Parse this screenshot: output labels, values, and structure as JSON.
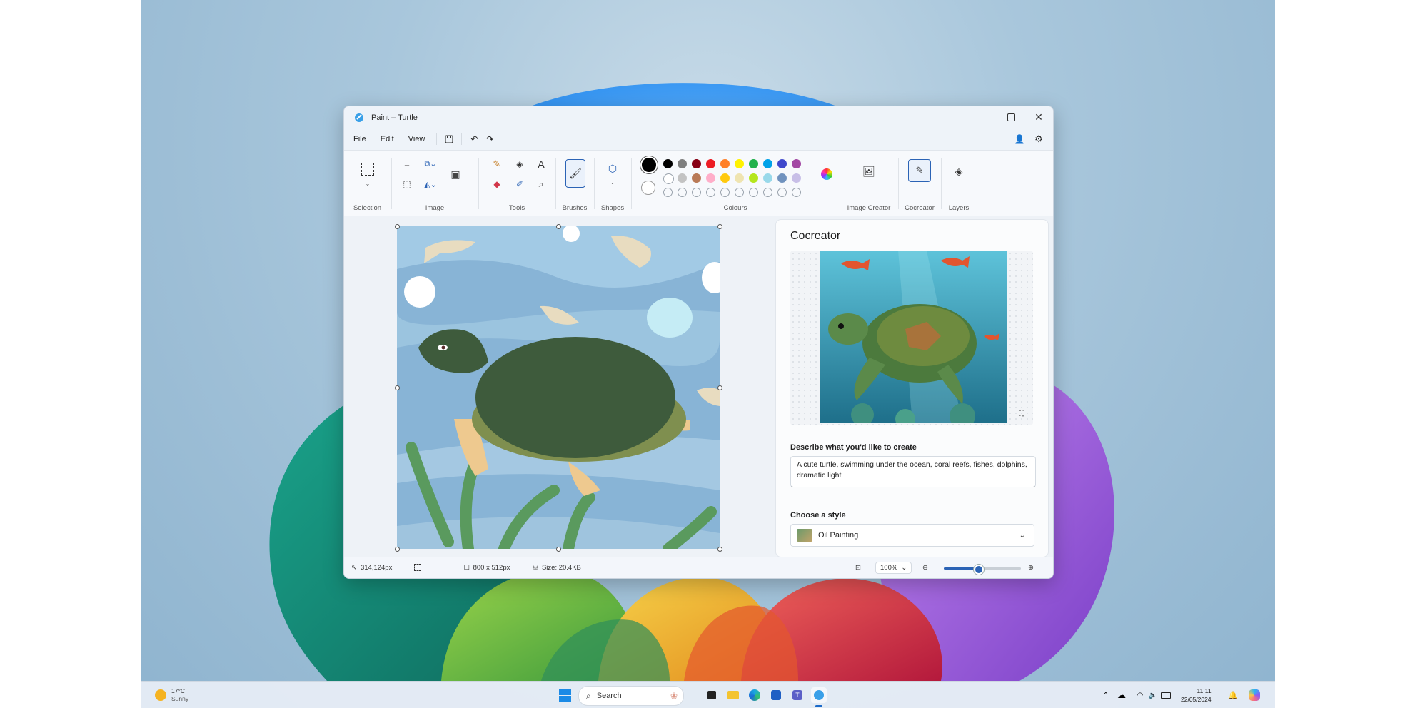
{
  "window": {
    "title": "Paint – Turtle",
    "minimize_icon": "minimize-icon",
    "maximize_icon": "maximize-icon",
    "close_icon": "close-icon"
  },
  "menu": {
    "file": "File",
    "edit": "Edit",
    "view": "View"
  },
  "ribbon": {
    "groups": {
      "selection": "Selection",
      "image": "Image",
      "tools": "Tools",
      "brushes": "Brushes",
      "shapes": "Shapes",
      "colours": "Colours",
      "image_creator": "Image Creator",
      "cocreator": "Cocreator",
      "layers": "Layers"
    },
    "palette_row1": [
      "#000000",
      "#7f7f7f",
      "#880015",
      "#ed1c24",
      "#ff7f27",
      "#fff200",
      "#22b14c",
      "#00a2e8",
      "#3f48cc",
      "#a349a4"
    ],
    "palette_row2": [
      "#ffffff",
      "#c3c3c3",
      "#b97a57",
      "#ffaec9",
      "#ffc90e",
      "#efe4b0",
      "#b5e61d",
      "#99d9ea",
      "#7092be",
      "#c8bfe7"
    ],
    "primary_color": "#000000",
    "secondary_color": "#ffffff"
  },
  "cocreator": {
    "title": "Cocreator",
    "prompt_label": "Describe what you'd like to create",
    "prompt_value": "A cute turtle, swimming under the ocean, coral reefs, fishes, dolphins, dramatic light",
    "style_label": "Choose a style",
    "style_value": "Oil Painting"
  },
  "status": {
    "cursor": "314,124px",
    "dimensions": "800 x 512px",
    "size": "Size: 20.4KB",
    "zoom": "100%",
    "zoom_level": 0.45
  },
  "taskbar": {
    "temp": "17°C",
    "weather": "Sunny",
    "search_placeholder": "Search",
    "time": "11:11",
    "date": "22/05/2024"
  }
}
